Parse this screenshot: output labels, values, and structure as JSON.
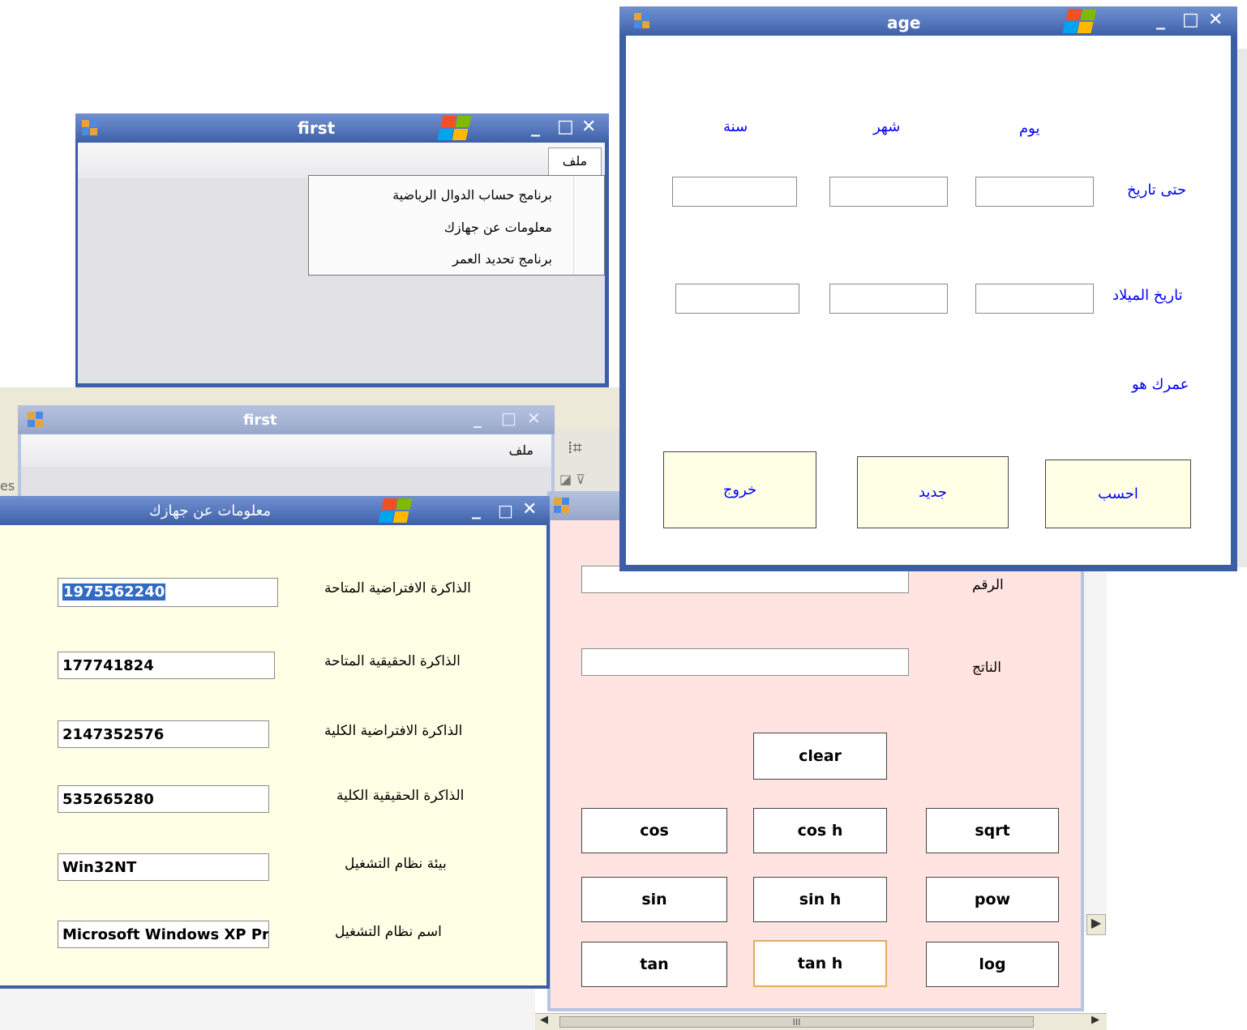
{
  "win_first1": {
    "title": "first",
    "menu_file": "ملف",
    "menu_items": [
      "برنامج حساب الدوال الرياضية",
      "معلومات عن جهازك",
      "برنامج تحديد العمر"
    ]
  },
  "win_first2": {
    "title": "first",
    "menu_file": "ملف"
  },
  "win_age": {
    "title": "age",
    "col_year": "سنة",
    "col_month": "شهر",
    "col_day": "يوم",
    "row_until": "حتى تاريخ",
    "row_birth": "تاريخ الميلاد",
    "your_age": "عمرك هو",
    "btn_exit": "خروج",
    "btn_new": "جديد",
    "btn_calc": "احسب"
  },
  "win_sysinfo": {
    "title": "معلومات عن جهازك",
    "rows": [
      {
        "label": "الذاكرة الافتراضية المتاحة",
        "value": "1975562240"
      },
      {
        "label": "الذاكرة الحقيقية المتاحة",
        "value": "177741824"
      },
      {
        "label": "الذاكرة الافتراضية الكلية",
        "value": "2147352576"
      },
      {
        "label": "الذاكرة الحقيقية الكلية",
        "value": "535265280"
      },
      {
        "label": "بيئة نظام التشغيل",
        "value": "Win32NT"
      },
      {
        "label": "اسم نظام التشغيل",
        "value": "Microsoft Windows XP Pro"
      }
    ]
  },
  "win_calc": {
    "number_label": "الرقم",
    "result_label": "الناتج",
    "number_value": "",
    "result_value": "",
    "buttons": {
      "clear": "clear",
      "cos": "cos",
      "cosh": "cos h",
      "sqrt": "sqrt",
      "sin": "sin",
      "sinh": "sin h",
      "pow": "pow",
      "tan": "tan",
      "tanh": "tan h",
      "log": "log"
    }
  },
  "background": {
    "fragment_es": "es",
    "scroll_grip": "III"
  },
  "colors": {
    "title_active": "#4a6bb0",
    "form_gray": "#e1e1e6",
    "age_button": "#ffffe6",
    "age_label_blue": "#0000ff",
    "sysinfo_bg": "#ffffe6",
    "calc_bg": "#ffe4e1"
  },
  "icons": [
    "app-icon",
    "windows-logo-icon",
    "minimize-icon",
    "maximize-icon",
    "close-icon"
  ]
}
